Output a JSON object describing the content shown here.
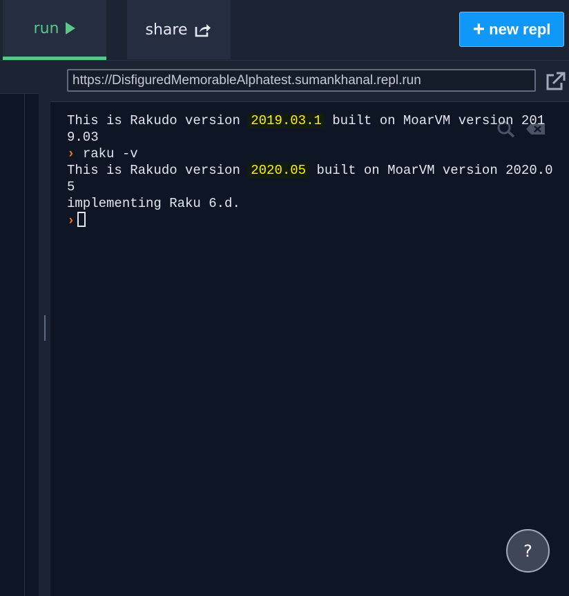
{
  "header": {
    "run_label": "run",
    "share_label": "share",
    "new_repl_plus": "+",
    "new_repl_label": "new repl",
    "icons": [
      "play-icon",
      "share-icon",
      "plus-icon"
    ]
  },
  "console": {
    "url": "https://DisfiguredMemorableAlphatest.sumankhanal.repl.run",
    "prompt_symbol": "›",
    "lines": [
      {
        "pre": "This is Rakudo version ",
        "version": "2019.03.1",
        "post": " built on MoarVM version 2019.03"
      },
      {
        "command": "raku -v"
      },
      {
        "pre": "This is Rakudo version ",
        "version": "2020.05",
        "post": " built on MoarVM version 2020.05"
      },
      {
        "text": "implementing Raku 6.d."
      }
    ],
    "icons": [
      "open-in-new-tab-icon",
      "search-icon",
      "clear-console-icon"
    ]
  },
  "help": {
    "label": "?"
  },
  "colors": {
    "accent_green": "#58c886",
    "button_blue": "#0f98f7",
    "highlight_yellow": "#fff200",
    "prompt_orange": "#f0731c",
    "background": "#0e1525",
    "panel": "#1c2333"
  }
}
